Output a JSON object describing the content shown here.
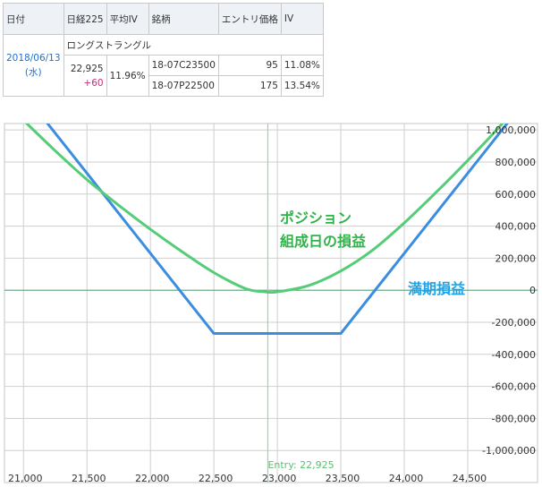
{
  "table": {
    "headers": [
      "日付",
      "日経225",
      "平均IV",
      "銘柄",
      "エントリ価格",
      "IV"
    ],
    "strategy": "ロングストラングル",
    "date": "2018/06/13",
    "weekday": "(水)",
    "nikkei": "22,925",
    "nikkei_change": "+60",
    "avg_iv": "11.96%",
    "rows": [
      {
        "symbol": "18-07C23500",
        "price": "95",
        "iv": "11.08%"
      },
      {
        "symbol": "18-07P22500",
        "price": "175",
        "iv": "13.54%"
      }
    ]
  },
  "chart_data": {
    "type": "line",
    "xlim": [
      20850,
      25050
    ],
    "ylim": [
      -1200000,
      1040000
    ],
    "x_ticks": [
      21000,
      21500,
      22000,
      22500,
      23000,
      23500,
      24000,
      24500
    ],
    "x_tick_labels": [
      "21,000",
      "21,500",
      "22,000",
      "22,500",
      "23,000",
      "23,500",
      "24,000",
      "24,500"
    ],
    "y_ticks": [
      1000000,
      800000,
      600000,
      400000,
      200000,
      0,
      -200000,
      -400000,
      -600000,
      -800000,
      -1000000
    ],
    "y_tick_labels": [
      "1,000,000",
      "800,000",
      "600,000",
      "400,000",
      "200,000",
      "0",
      "-200,000",
      "-400,000",
      "-600,000",
      "-800,000",
      "-1,000,000"
    ],
    "grid": true,
    "series": [
      {
        "name": "満期損益",
        "color": "#3b8de0",
        "x": [
          21000,
          22500,
          23500,
          25000
        ],
        "y": [
          1230000,
          -270000,
          -270000,
          1230000
        ]
      },
      {
        "name": "ポジション組成日の損益",
        "color": "#55cc77",
        "x": [
          21000,
          21250,
          21500,
          21750,
          22000,
          22250,
          22500,
          22750,
          22900,
          23000,
          23250,
          23500,
          23750,
          24000,
          24250,
          24500,
          24750,
          25000
        ],
        "y": [
          1060000,
          870000,
          690000,
          530000,
          380000,
          240000,
          110000,
          10000,
          -10000,
          -10000,
          30000,
          120000,
          250000,
          420000,
          610000,
          810000,
          1020000,
          1250000
        ]
      }
    ],
    "entry_line": {
      "x": 22925,
      "label": "Entry: 22,925",
      "color": "#8fdc9f"
    },
    "zero_line_color": "#5aa07a",
    "annotations": {
      "green_line1": "ポジション",
      "green_line2": "組成日の損益",
      "blue": "満期損益"
    }
  }
}
